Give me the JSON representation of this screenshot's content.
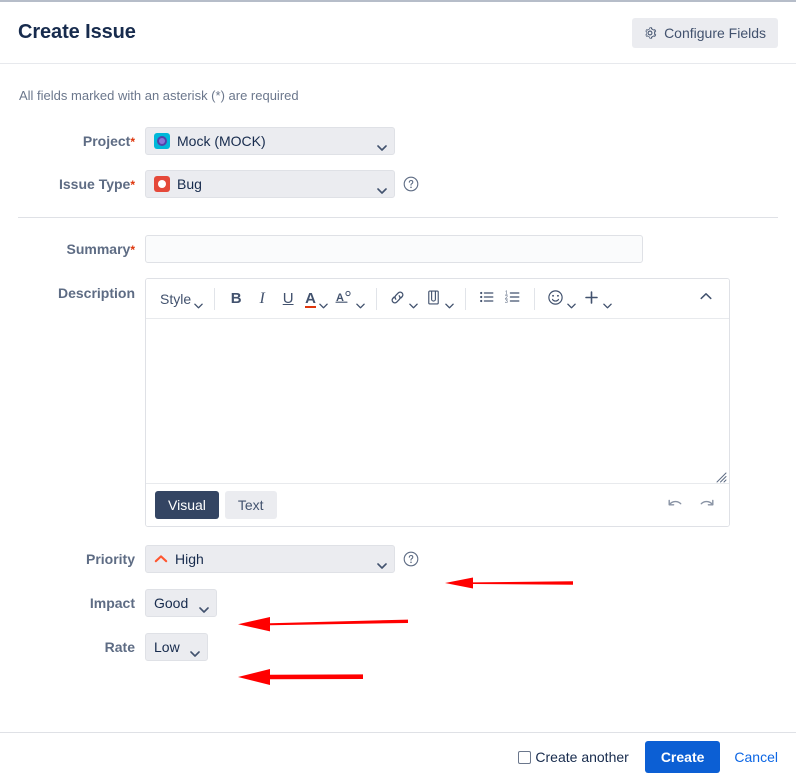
{
  "dialog": {
    "title": "Create Issue",
    "configure_fields_label": "Configure Fields",
    "configure_icon": "gear-icon",
    "required_note": "All fields marked with an asterisk (*) are required"
  },
  "fields": {
    "project": {
      "label": "Project",
      "required_mark": "*",
      "value": "Mock (MOCK)",
      "icon": "project-avatar-icon",
      "icon_color": "#00b8d9"
    },
    "issue_type": {
      "label": "Issue Type",
      "required_mark": "*",
      "value": "Bug",
      "icon": "bug-icon",
      "icon_color": "#e5493a",
      "help_icon": "help-circle-icon"
    },
    "summary": {
      "label": "Summary",
      "required_mark": "*",
      "value": "",
      "placeholder": ""
    },
    "description": {
      "label": "Description",
      "value": ""
    },
    "priority": {
      "label": "Priority",
      "value": "High",
      "icon": "priority-high-icon",
      "icon_color": "#ff5630",
      "help_icon": "help-circle-icon"
    },
    "impact": {
      "label": "Impact",
      "value": "Good"
    },
    "rate": {
      "label": "Rate",
      "value": "Low"
    }
  },
  "editor": {
    "toolbar": {
      "style_label": "Style",
      "bold_label": "B",
      "italic_label": "I",
      "underline_label": "U",
      "text_color_label": "A",
      "text_style_label": "A",
      "link_icon": "link-icon",
      "attach_icon": "paperclip-icon",
      "bullet_list_icon": "bullet-list-icon",
      "numbered_list_icon": "numbered-list-icon",
      "emoji_icon": "emoji-icon",
      "plus_icon": "plus-icon",
      "collapse_icon": "chevron-up-double-icon"
    },
    "modes": {
      "visual_label": "Visual",
      "text_label": "Text",
      "active": "Visual"
    },
    "undo_icon": "undo-icon",
    "redo_icon": "redo-icon",
    "content": ""
  },
  "footer": {
    "create_another_label": "Create another",
    "create_another_checked": false,
    "create_label": "Create",
    "cancel_label": "Cancel",
    "create_button_color": "#0c5fd4"
  },
  "annotations": {
    "color": "#ff0000",
    "arrows": [
      {
        "name": "priority-arrow",
        "target": "priority",
        "direction": "left"
      },
      {
        "name": "impact-arrow",
        "target": "impact",
        "direction": "left"
      },
      {
        "name": "rate-arrow",
        "target": "rate",
        "direction": "left"
      }
    ]
  }
}
